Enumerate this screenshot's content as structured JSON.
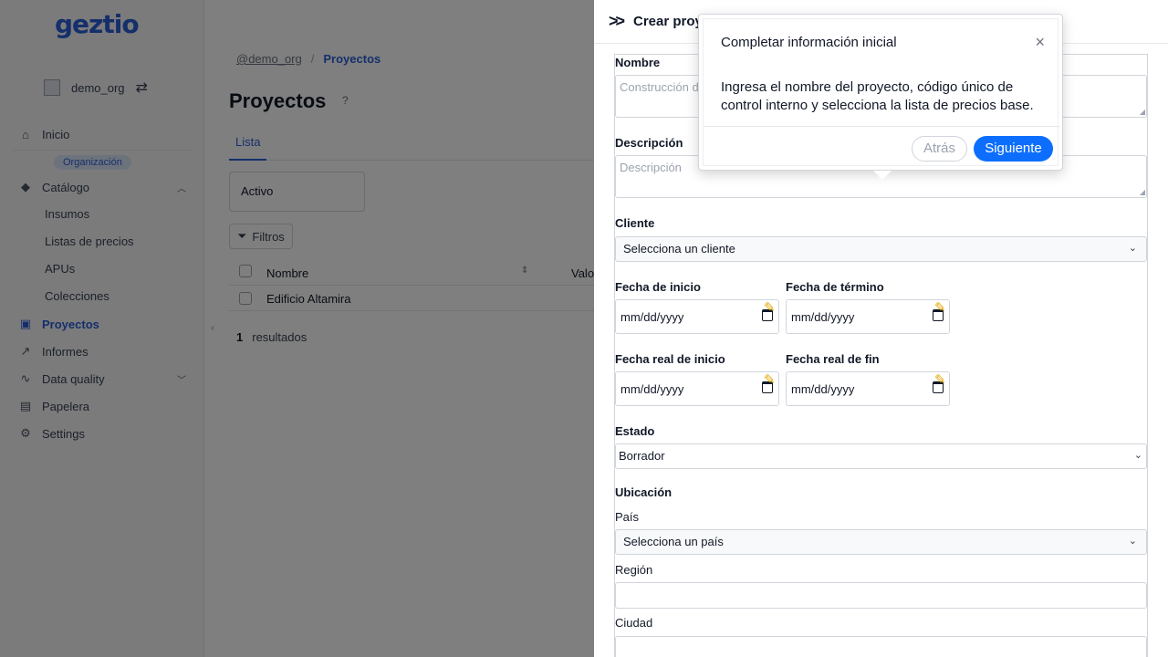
{
  "app": {
    "logo": "geztio",
    "org": {
      "name": "demo_org",
      "badge": "Organización"
    },
    "nav": {
      "inicio": "Inicio",
      "catalogo": "Catálogo",
      "insumos": "Insumos",
      "listas_precios": "Listas de precios",
      "apus": "APUs",
      "colecciones": "Colecciones",
      "proyectos": "Proyectos",
      "informes": "Informes",
      "data_quality": "Data quality",
      "papelera": "Papelera",
      "settings": "Settings"
    },
    "breadcrumb": {
      "org": "@demo_org",
      "separator": "/",
      "current": "Proyectos"
    },
    "page_title": "Proyectos",
    "help": "?",
    "tab": "Lista",
    "status_filter": "Activo",
    "filters_button": "Filtros",
    "table": {
      "headers": [
        "Nombre",
        "Valo"
      ],
      "rows": [
        {
          "nombre": "Edificio Altamira"
        }
      ]
    },
    "results": {
      "count": "1",
      "label": "resultados"
    }
  },
  "drawer": {
    "title": "Crear proy",
    "fields": {
      "nombre": {
        "label": "Nombre",
        "placeholder": "Construcción d"
      },
      "descripcion": {
        "label": "Descripción",
        "placeholder": "Descripción"
      },
      "cliente": {
        "label": "Cliente",
        "value": "Selecciona un cliente"
      },
      "fecha_inicio": {
        "label": "Fecha de inicio",
        "value": "mm/dd/yyyy"
      },
      "fecha_termino": {
        "label": "Fecha de término",
        "value": "mm/dd/yyyy"
      },
      "fecha_real_inicio": {
        "label": "Fecha real de inicio",
        "value": "mm/dd/yyyy"
      },
      "fecha_real_fin": {
        "label": "Fecha real de fin",
        "value": "mm/dd/yyyy"
      },
      "estado": {
        "label": "Estado",
        "value": "Borrador"
      },
      "ubicacion": {
        "label": "Ubicación"
      },
      "pais": {
        "label": "País",
        "value": "Selecciona un país"
      },
      "region": {
        "label": "Región",
        "value": ""
      },
      "ciudad": {
        "label": "Ciudad",
        "value": ""
      }
    }
  },
  "tour": {
    "title": "Completar información inicial",
    "body": "Ingresa el nombre del proyecto, código único de control interno y selecciona la lista de precios base.",
    "back": "Atrás",
    "next": "Siguiente",
    "close": "×"
  },
  "colors": {
    "accent": "#2a5fd6",
    "primary_button": "#0d6efd",
    "edit_icon": "#e0a800",
    "overlay": "rgba(0,0,0,0.5)"
  }
}
